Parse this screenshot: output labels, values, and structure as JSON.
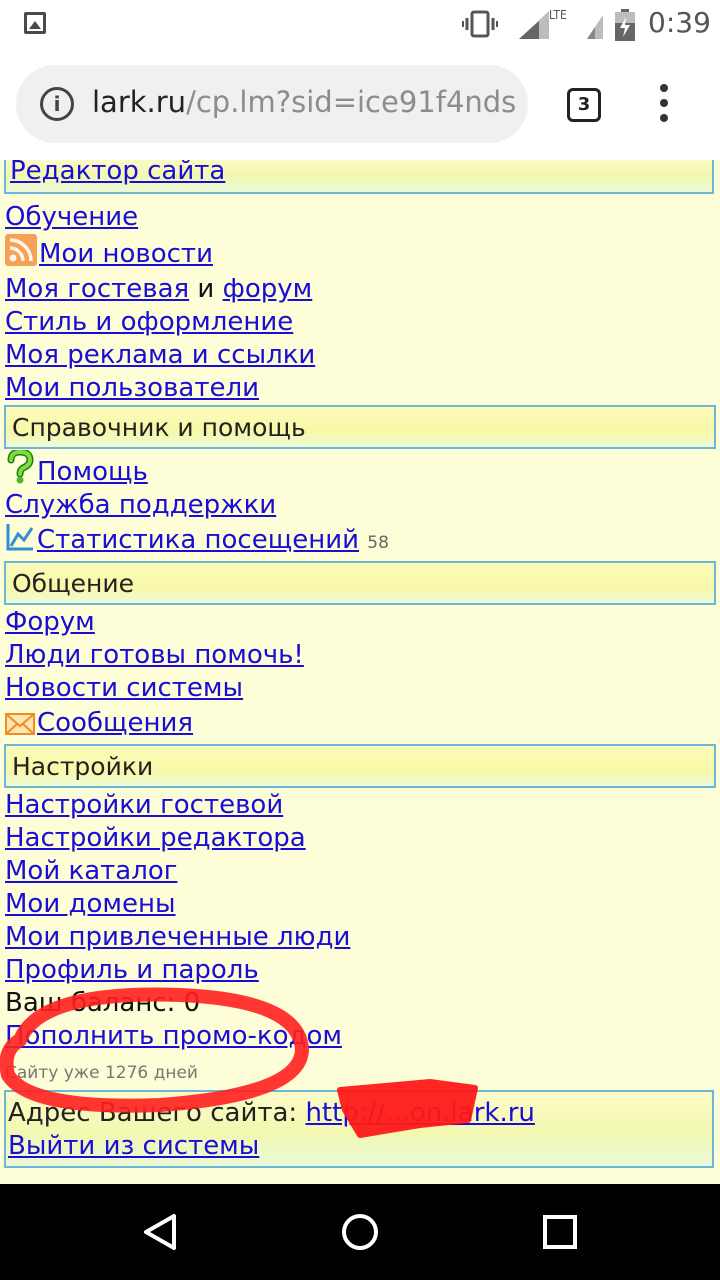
{
  "status_bar": {
    "time": "0:39",
    "network": "LTE"
  },
  "browser": {
    "url_host": "lark.ru",
    "url_path": "/cp.lm?sid=ice91f4nds",
    "tab_count": "3"
  },
  "top_link": "Редактор сайта",
  "links_group1": {
    "learning": "Обучение",
    "news": "Мои новости",
    "guestbook": "Моя гостевая",
    "and": " и ",
    "forum": "форум",
    "style": "Стиль и оформление",
    "ads": "Моя реклама и ссылки",
    "users": "Мои пользователи"
  },
  "sections": {
    "help": "Справочник и помощь",
    "communication": "Общение",
    "settings": "Настройки"
  },
  "help_links": {
    "help": "Помощь",
    "support": "Служба поддержки",
    "stats": "Статистика посещений",
    "stats_count": "58"
  },
  "comm_links": {
    "forum": "Форум",
    "helpers": "Люди готовы помочь!",
    "system_news": "Новости системы",
    "messages": "Сообщения"
  },
  "settings_links": {
    "guestbook_settings": "Настройки гостевой",
    "editor_settings": "Настройки редактора",
    "catalog": "Мой каталог",
    "domains": "Мои домены",
    "referrals": "Мои привлеченные люди",
    "profile": "Профиль и пароль"
  },
  "balance": "Ваш баланс: 0",
  "promo_link": "Пополнить промо-кодом",
  "site_age": "Сайту уже 1276 дней",
  "footer": {
    "address_label": "Адрес Вашего сайта: ",
    "address_url": "http://...on.lark.ru",
    "logout": "Выйти из системы"
  },
  "colors": {
    "link": "#1a0dd6",
    "section_border": "#6bb7d4",
    "page_bg": "#fdfdd8",
    "annotation": "#ff2020"
  }
}
